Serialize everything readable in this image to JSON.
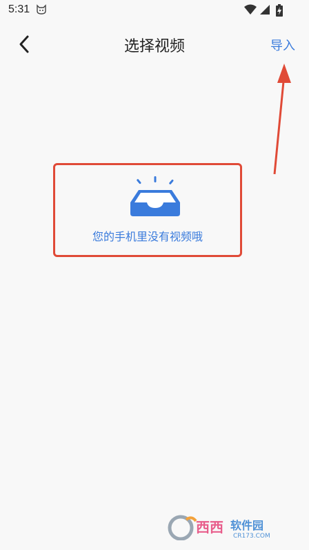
{
  "status_bar": {
    "time": "5:31",
    "notification_icon": "cat-icon",
    "wifi_icon": "wifi-icon",
    "signal_icon": "cellular-signal-icon",
    "battery_icon": "battery-charging-icon"
  },
  "app_bar": {
    "back_icon": "chevron-left-icon",
    "title": "选择视频",
    "import_label": "导入"
  },
  "empty_state": {
    "icon": "empty-inbox-icon",
    "message": "您的手机里没有视频哦"
  },
  "watermark": {
    "text": "西西软件园",
    "subtext": "CR173.COM"
  },
  "colors": {
    "accent": "#3a7bdc",
    "annotation": "#e04a37",
    "background": "#f8f8f8",
    "title": "#222222"
  }
}
